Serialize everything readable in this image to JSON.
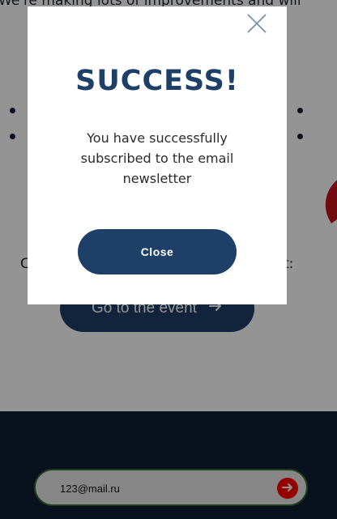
{
  "background": {
    "intro_text": "We're making lots of improvements and will",
    "partial_left": "C",
    "partial_right": "t:",
    "event_button_label": "Go to the event",
    "email_input": {
      "value": "123@mail.ru",
      "placeholder": ""
    }
  },
  "modal": {
    "title": "SUCCESS!",
    "message": "You have successfully subscribed to the email newsletter",
    "close_button_label": "Close"
  },
  "colors": {
    "brand_navy": "#1e3f67",
    "footer_navy": "#0f1e33",
    "accent_red": "#ff0000",
    "input_border_green": "#2f6d2a"
  },
  "icons": {
    "modal_close": "close-icon",
    "event_arrow": "arrow-right-icon",
    "submit_arrow": "arrow-right-icon"
  }
}
